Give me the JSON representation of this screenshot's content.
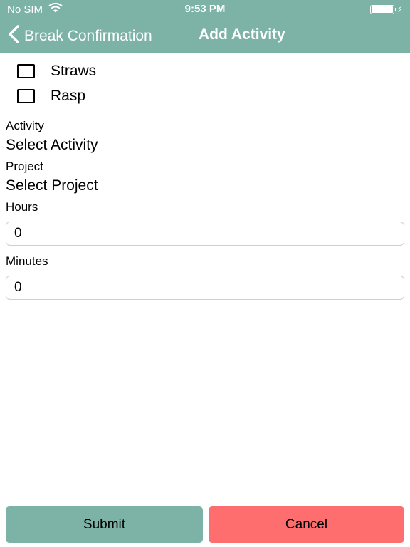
{
  "status_bar": {
    "carrier": "No SIM",
    "time": "9:53 PM",
    "battery_level": 1.0
  },
  "nav": {
    "back_label": "Break Confirmation",
    "title": "Add Activity"
  },
  "checklist": [
    {
      "label": "Straws",
      "checked": false
    },
    {
      "label": "Rasp",
      "checked": false
    }
  ],
  "form": {
    "activity_label": "Activity",
    "activity_value": "Select Activity",
    "project_label": "Project",
    "project_value": "Select Project",
    "hours_label": "Hours",
    "hours_value": "0",
    "minutes_label": "Minutes",
    "minutes_value": "0"
  },
  "actions": {
    "submit_label": "Submit",
    "cancel_label": "Cancel"
  },
  "colors": {
    "header": "#7db3a7",
    "submit": "#7db3a7",
    "cancel": "#ff6e6e"
  }
}
